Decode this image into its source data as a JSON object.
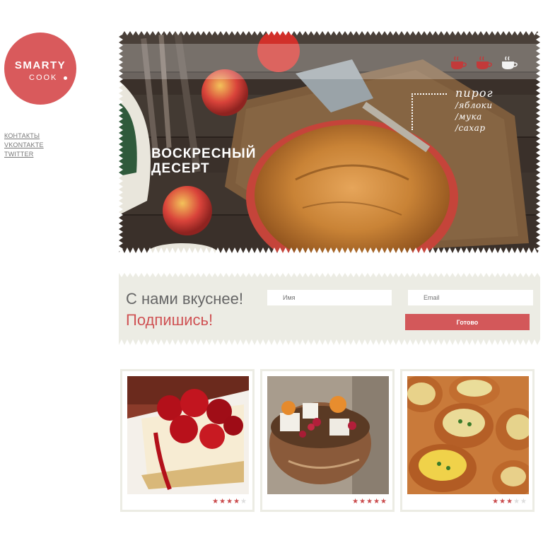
{
  "logo": {
    "line1": "SMARTY",
    "line2": "COOK"
  },
  "nav": {
    "items": [
      {
        "label": "КОНТАКТЫ"
      },
      {
        "label": "VKONTAKTE"
      },
      {
        "label": "TWITTER"
      }
    ]
  },
  "hero": {
    "title_line1": "ВОСКРЕСНЫЙ",
    "title_line2": "ДЕСЕРТ",
    "recipe_name": "пирог",
    "ingredients": [
      "/яблоки",
      "/мука",
      "/сахар"
    ],
    "difficulty_cups": 3,
    "difficulty_filled": 2
  },
  "subscribe": {
    "line1": "С нами вкуснее!",
    "line2": "Подпишись!",
    "name_placeholder": "Имя",
    "email_placeholder": "Email",
    "submit_label": "Готово"
  },
  "cards": [
    {
      "name": "cheesecake",
      "rating": 3.5
    },
    {
      "name": "salad",
      "rating": 5
    },
    {
      "name": "bread-bowls",
      "rating": 2.5
    }
  ],
  "colors": {
    "accent": "#d3585a",
    "panel": "#ecece4"
  }
}
